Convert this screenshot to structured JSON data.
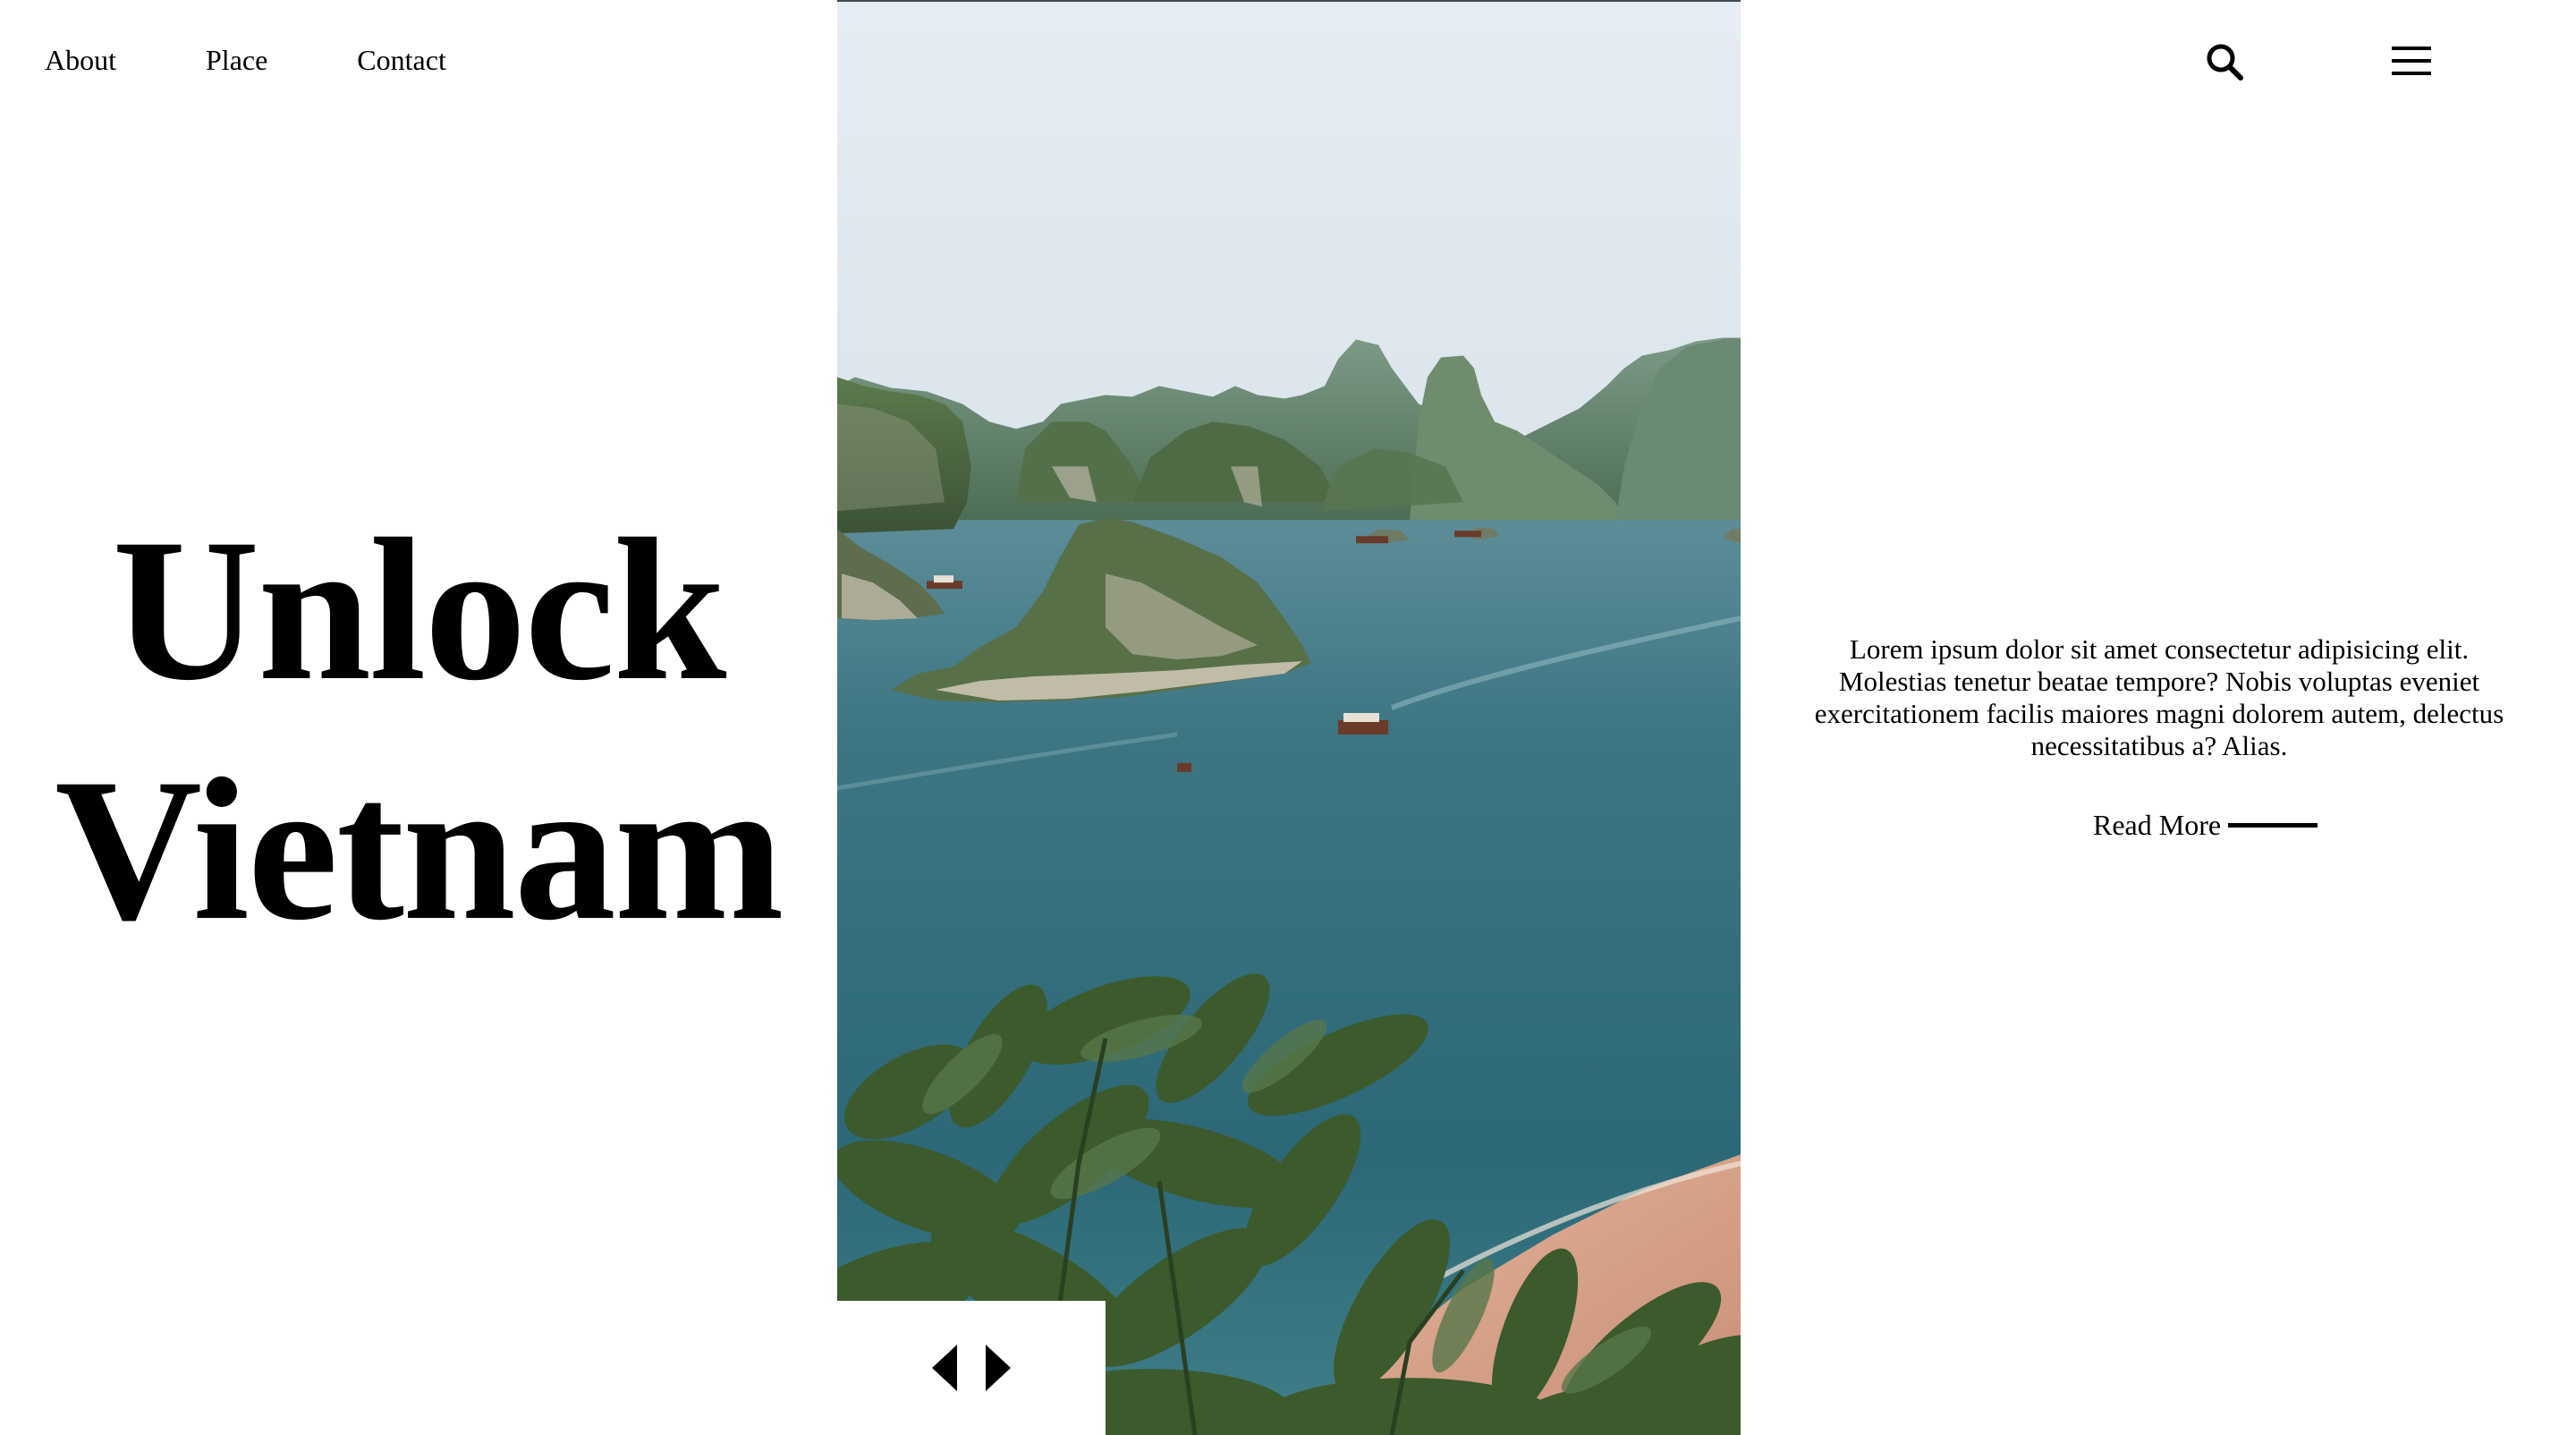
{
  "nav": {
    "links": [
      {
        "label": "About"
      },
      {
        "label": "Place"
      },
      {
        "label": "Contact"
      }
    ],
    "search_icon": "search-icon",
    "menu_icon": "hamburger-menu-icon"
  },
  "hero": {
    "title_line1": "Unlock",
    "title_line2": "Vietnam",
    "image": {
      "subject": "Ha Long Bay: limestone karst islands, turquoise water, boats, beach and foreground foliage"
    }
  },
  "slider": {
    "prev_icon": "caret-left-icon",
    "next_icon": "caret-right-icon"
  },
  "description": {
    "text": "Lorem ipsum dolor sit amet consectetur adipisicing elit. Molestias tenetur beatae tempore? Nobis voluptas eveniet exercitationem facilis maiores magni dolorem autem, delectus necessitatibus a? Alias.",
    "read_more_label": "Read More"
  },
  "colors": {
    "background": "#ffffff",
    "text": "#000000",
    "sky": "#dfe9ef",
    "water": "#2f6b7a",
    "foliage": "#3f5a2c",
    "sand": "#d9a58c"
  }
}
